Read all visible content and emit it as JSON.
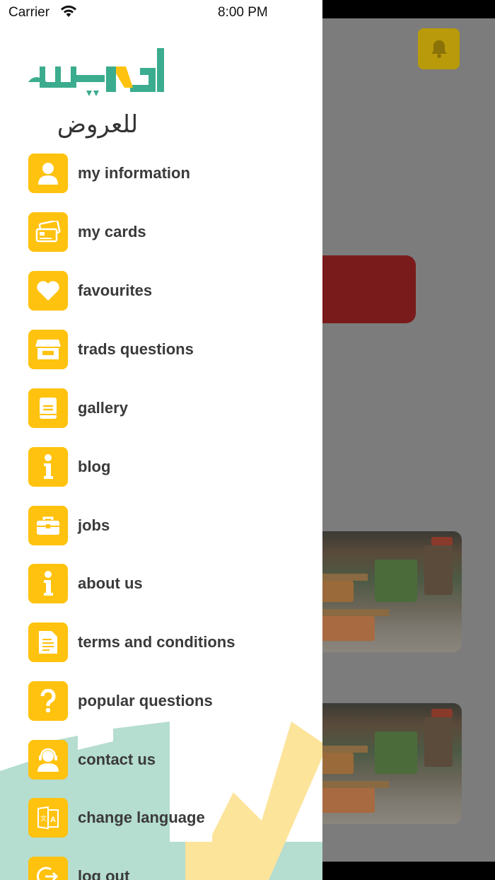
{
  "status_bar": {
    "carrier": "Carrier",
    "time": "8:00 PM"
  },
  "logo": {
    "subtitle": "للعروض",
    "brand_colors": {
      "green": "#3cac8e",
      "yellow": "#ffc20e"
    }
  },
  "menu": {
    "items": [
      {
        "label": "my information",
        "icon": "user-icon"
      },
      {
        "label": "my cards",
        "icon": "cards-icon"
      },
      {
        "label": "favourites",
        "icon": "heart-icon"
      },
      {
        "label": "trads questions",
        "icon": "store-icon"
      },
      {
        "label": "gallery",
        "icon": "book-icon"
      },
      {
        "label": "blog",
        "icon": "info-icon"
      },
      {
        "label": "jobs",
        "icon": "briefcase-icon"
      },
      {
        "label": "about us",
        "icon": "info-icon"
      },
      {
        "label": "terms and conditions",
        "icon": "document-icon"
      },
      {
        "label": "popular questions",
        "icon": "question-icon"
      },
      {
        "label": "contact us",
        "icon": "support-agent-icon"
      },
      {
        "label": "change language",
        "icon": "translate-icon"
      },
      {
        "label": "log out",
        "icon": "logout-icon"
      }
    ]
  },
  "colors": {
    "accent": "#ffc20e",
    "overlay": "#7c7c7c",
    "text": "#3a3a3a"
  }
}
